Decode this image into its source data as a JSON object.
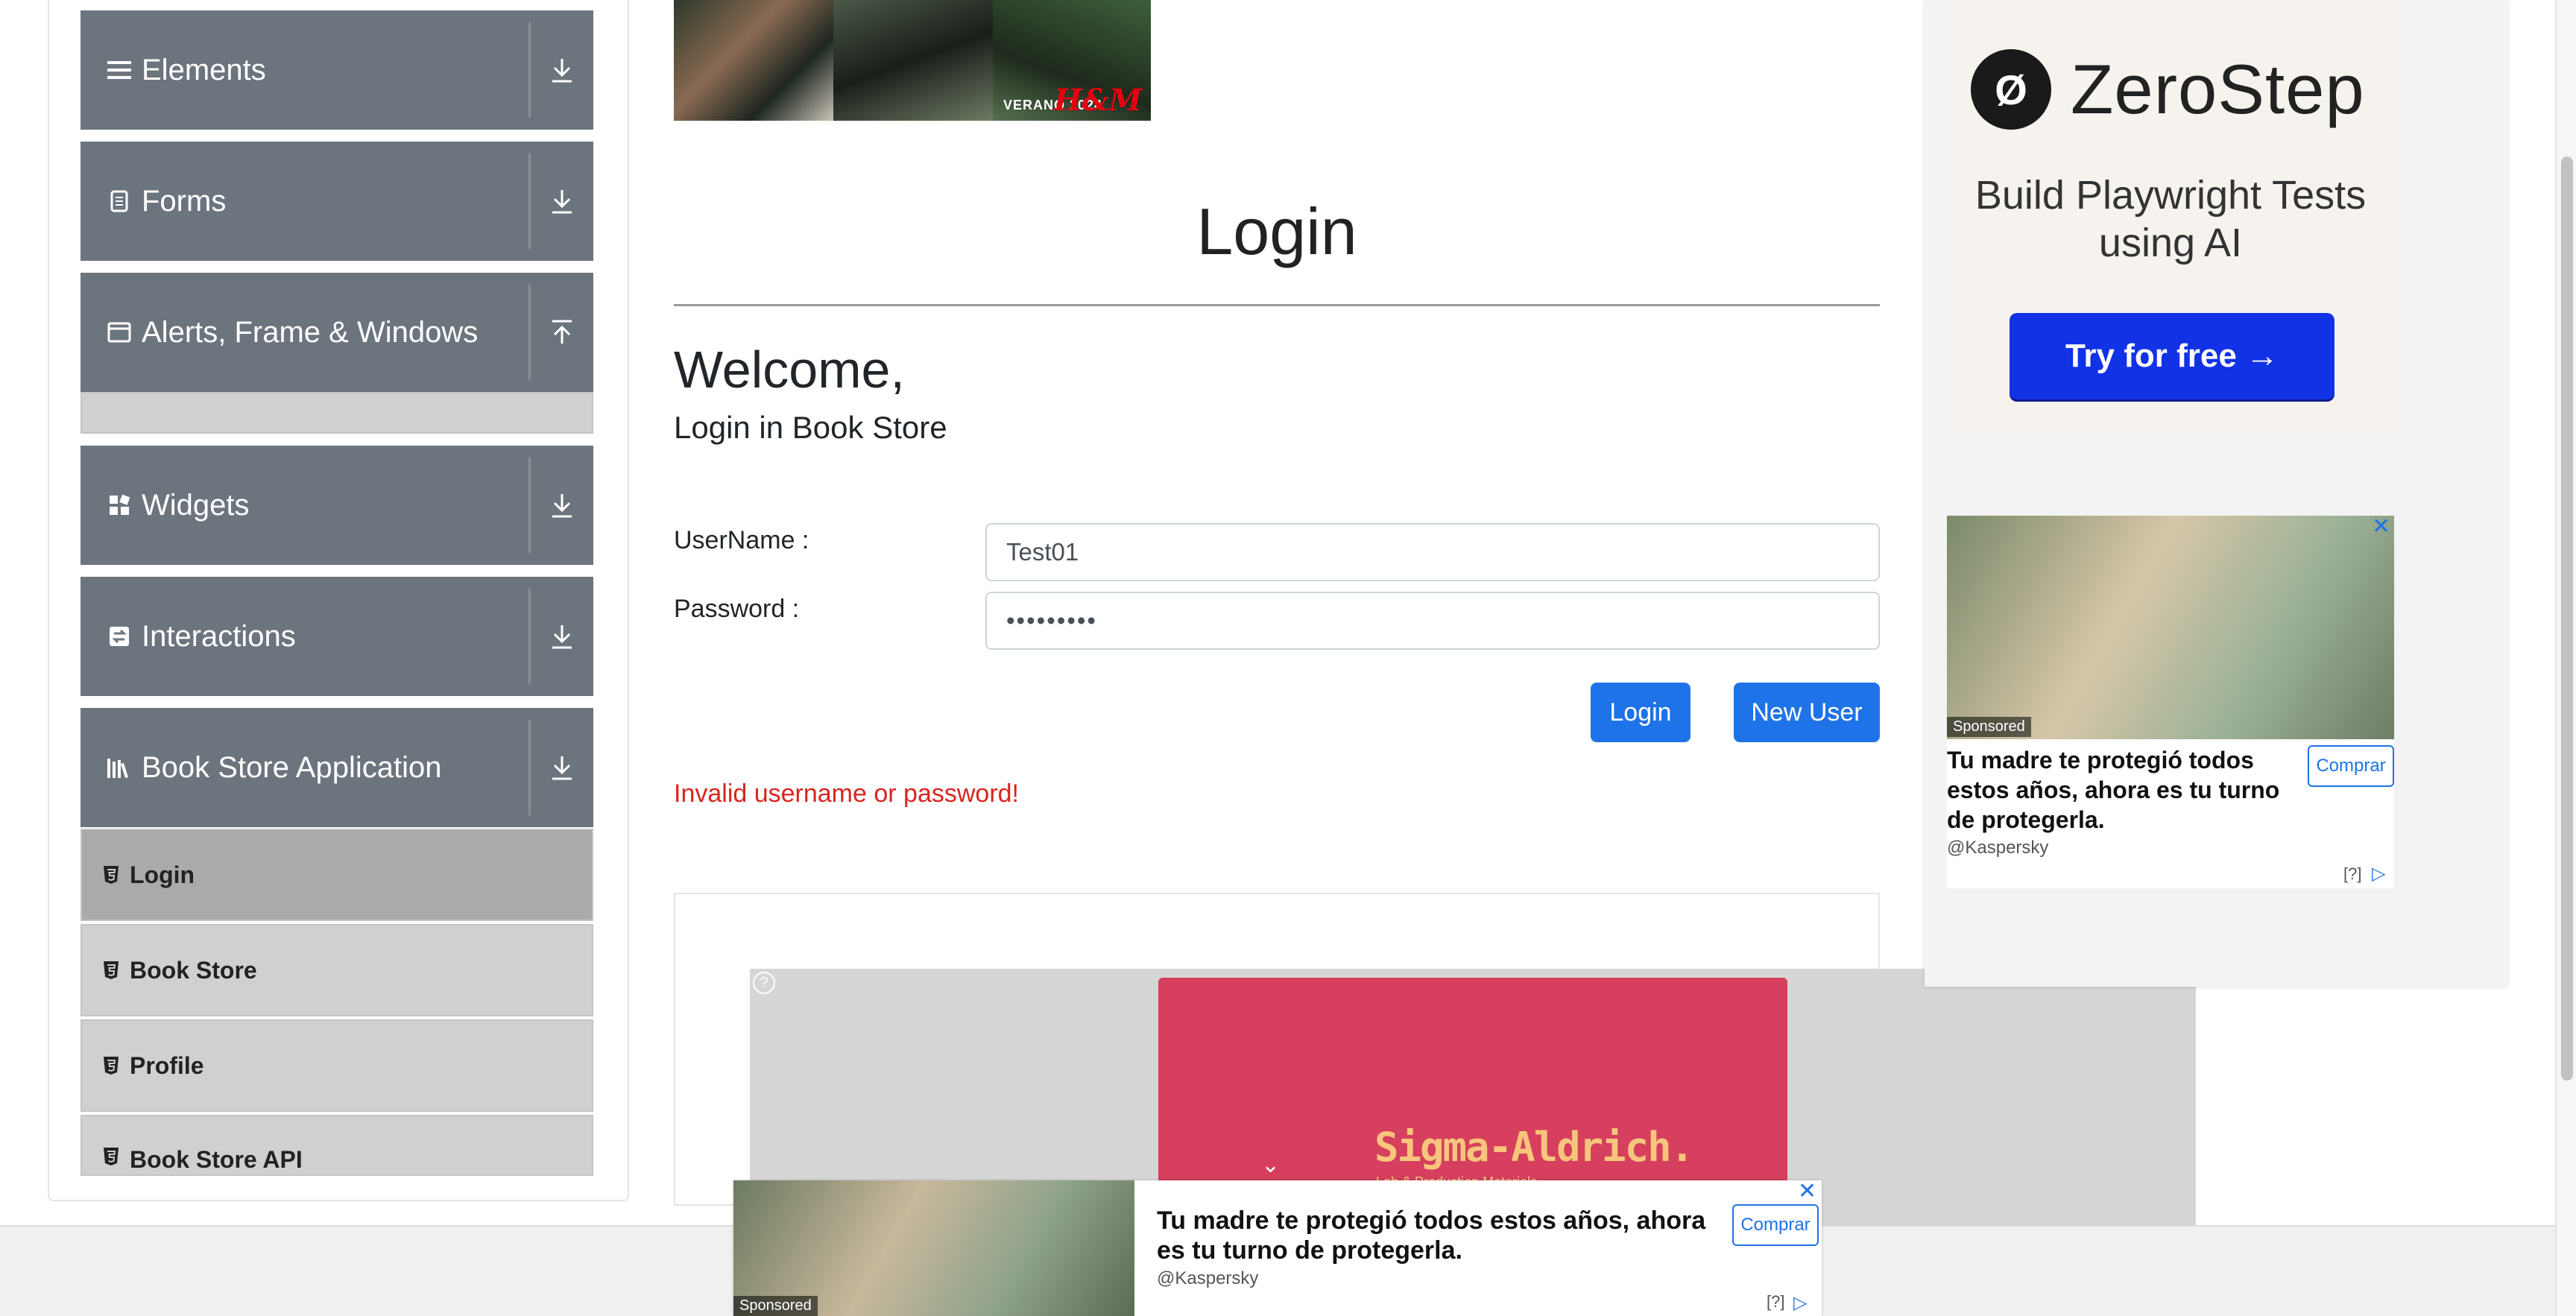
{
  "sidebar": {
    "groups": [
      {
        "title": "Elements",
        "icon": "hamburger-icon",
        "arrow": "download-arrow-icon"
      },
      {
        "title": "Forms",
        "icon": "document-icon",
        "arrow": "download-arrow-icon"
      },
      {
        "title": "Alerts, Frame & Windows",
        "icon": "window-icon",
        "arrow": "upload-arrow-icon"
      },
      {
        "title": "Widgets",
        "icon": "widgets-icon",
        "arrow": "download-arrow-icon"
      },
      {
        "title": "Interactions",
        "icon": "interactions-icon",
        "arrow": "download-arrow-icon"
      },
      {
        "title": "Book Store Application",
        "icon": "books-icon",
        "arrow": "download-arrow-icon"
      }
    ],
    "book_store_items": [
      {
        "label": "Login",
        "active": true
      },
      {
        "label": "Book Store",
        "active": false
      },
      {
        "label": "Profile",
        "active": false
      },
      {
        "label": "Book Store API",
        "active": false
      }
    ]
  },
  "banner": {
    "text": "VERANO 2024",
    "brand": "H&M"
  },
  "main": {
    "title": "Login",
    "welcome": "Welcome,",
    "subheading": "Login in Book Store",
    "username_label": "UserName :",
    "username_value": "Test01",
    "password_label": "Password :",
    "password_value": "•••••••••",
    "login_button": "Login",
    "new_user_button": "New User",
    "error": "Invalid username or password!"
  },
  "sigma_ad": {
    "brand": "Sigma-Aldrich.",
    "tagline": "Lab & Production Materials",
    "info": "?"
  },
  "zerostep_ad": {
    "brand": "ZeroStep",
    "tagline": "Build Playwright Tests using AI",
    "cta": "Try for free →"
  },
  "kaspersky_ad": {
    "sponsored": "Sponsored",
    "headline": "Tu madre te protegió todos estos años, ahora es tu turno de protegerla.",
    "advertiser": "@Kaspersky",
    "button": "Comprar",
    "adchoices": "[?]",
    "close": "✕"
  },
  "colors": {
    "sidebar_header": "#6c757d",
    "primary": "#1e73e8",
    "error": "#d7261e",
    "zerostep_cta": "#1232e6",
    "sigma_bg": "#d63f5e"
  }
}
